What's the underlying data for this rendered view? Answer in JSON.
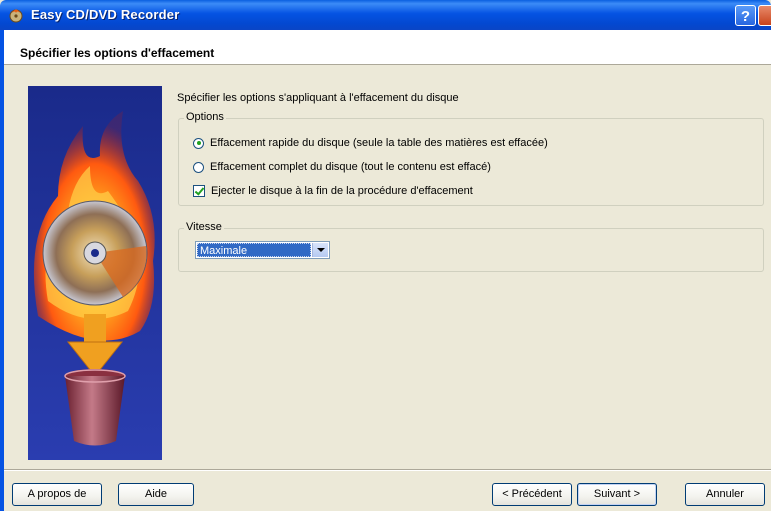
{
  "window": {
    "title": "Easy CD/DVD Recorder",
    "help_label": "?"
  },
  "header": {
    "title": "Spécifier les options d'effacement"
  },
  "intro": "Spécifier les options s'appliquant à l'effacement du disque",
  "options": {
    "legend": "Options",
    "items": [
      {
        "label": "Effacement rapide du disque (seule la table des matières est effacée)",
        "type": "radio",
        "selected": true
      },
      {
        "label": "Effacement complet du disque (tout le contenu est effacé)",
        "type": "radio",
        "selected": false
      }
    ],
    "eject": {
      "label": "Ejecter le disque à la fin de la procédure d'effacement",
      "checked": true
    }
  },
  "speed": {
    "legend": "Vitesse",
    "selected": "Maximale"
  },
  "buttons": {
    "about": "A propos de",
    "help": "Aide",
    "previous": "< Précédent",
    "next": "Suivant >",
    "cancel": "Annuler"
  },
  "colors": {
    "titlebar": "#0553e3",
    "dialog_bg": "#ece9d8",
    "selection": "#316ac5",
    "art_bg": "#1c2a8c"
  },
  "icons": {
    "app": "flame-disc-icon",
    "art": "disc-burning-trash-illustration"
  }
}
